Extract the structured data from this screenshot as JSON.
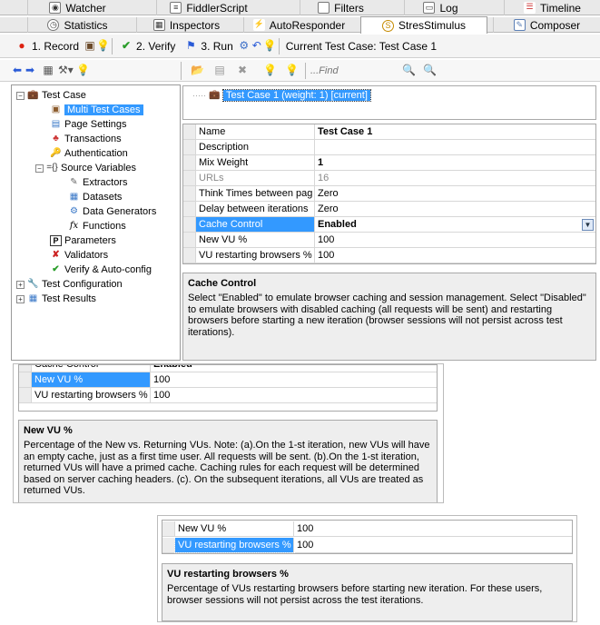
{
  "tabs_top": [
    {
      "label": "Watcher",
      "icon": "watcher-icon"
    },
    {
      "label": "FiddlerScript",
      "icon": "script-icon"
    },
    {
      "label": "Filters",
      "icon": "filters-icon"
    },
    {
      "label": "Log",
      "icon": "log-icon"
    },
    {
      "label": "Timeline",
      "icon": "timeline-icon"
    }
  ],
  "tabs_bottom": [
    {
      "label": "Statistics",
      "icon": "stopwatch-icon"
    },
    {
      "label": "Inspectors",
      "icon": "inspectors-icon"
    },
    {
      "label": "AutoResponder",
      "icon": "lightning-icon"
    },
    {
      "label": "StresStimulus",
      "icon": "stresstimulus-icon"
    },
    {
      "label": "Composer",
      "icon": "composer-icon"
    }
  ],
  "toolbar1": {
    "record": "1. Record",
    "verify": "2. Verify",
    "run": "3. Run",
    "current": "Current Test Case: Test Case 1"
  },
  "toolbar2": {
    "find_placeholder": "...Find"
  },
  "tree": {
    "root": "Test Case",
    "multi": "Multi Test Cases",
    "page_settings": "Page Settings",
    "transactions": "Transactions",
    "authentication": "Authentication",
    "source_variables": "Source Variables",
    "extractors": "Extractors",
    "datasets": "Datasets",
    "data_generators": "Data Generators",
    "functions": "Functions",
    "parameters": "Parameters",
    "validators": "Validators",
    "verify": "Verify & Auto-config",
    "test_config": "Test Configuration",
    "test_results": "Test Results"
  },
  "case_list": {
    "item": "Test Case 1 (weight: 1) [current]"
  },
  "grid": {
    "rows": [
      {
        "k": "Name",
        "v": "Test Case 1"
      },
      {
        "k": "Description",
        "v": ""
      },
      {
        "k": "Mix Weight",
        "v": "1"
      },
      {
        "k": "URLs",
        "v": "16"
      },
      {
        "k": "Think Times between pag",
        "v": "Zero"
      },
      {
        "k": "Delay between iterations",
        "v": "Zero"
      },
      {
        "k": "Cache Control",
        "v": "Enabled"
      },
      {
        "k": "New VU %",
        "v": "100"
      },
      {
        "k": "VU restarting browsers %",
        "v": "100"
      }
    ]
  },
  "help1": {
    "title": "Cache Control",
    "text": "Select \"Enabled\" to emulate browser caching and session management. Select \"Disabled\" to emulate browsers with disabled caching (all requests will be sent) and restarting browsers before starting a new iteration (browser sessions will not persist across test iterations)."
  },
  "snip2": {
    "partial_k": "Cache Control",
    "partial_v": "Enabled",
    "row1_k": "New VU %",
    "row1_v": "100",
    "row2_k": "VU restarting browsers %",
    "row2_v": "100",
    "title": "New VU %",
    "text": "Percentage of the New vs. Returning VUs. Note: (a).On the 1-st iteration, new VUs will have an empty cache, just as a first time user. All requests will be sent. (b).On the 1-st iteration, returned VUs will have a primed cache. Caching rules for each request will be determined based on server caching headers. (c). On the subsequent iterations, all VUs are treated as returned VUs."
  },
  "snip3": {
    "row1_k": "New VU %",
    "row1_v": "100",
    "row2_k": "VU restarting browsers %",
    "row2_v": "100",
    "title": "VU restarting browsers %",
    "text": "Percentage of VUs restarting browsers before starting new iteration. For these users, browser sessions will not persist across the test iterations."
  }
}
